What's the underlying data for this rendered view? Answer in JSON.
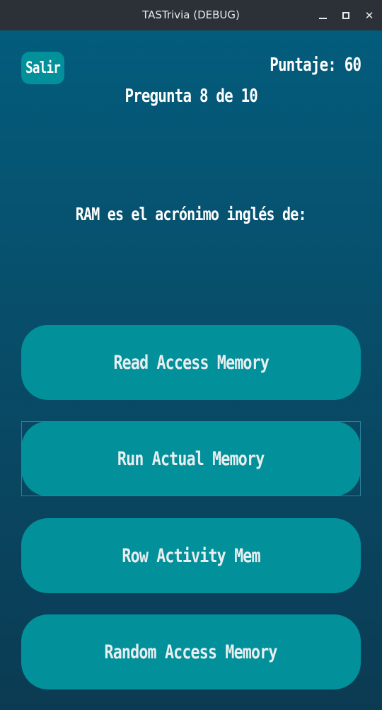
{
  "window": {
    "title": "TASTrivia (DEBUG)",
    "minimize_icon": "minimize-icon",
    "maximize_icon": "maximize-icon",
    "close_icon": "close-icon",
    "close_glyph": "✕"
  },
  "game": {
    "exit_label": "Salir",
    "score_label": "Puntaje: 60",
    "question_progress": "Pregunta 8 de 10",
    "question_text": "RAM es el acrónimo inglés de:",
    "answers": [
      "Read Access Memory",
      "Run Actual Memory",
      "Row Activity Mem",
      "Random Access Memory"
    ]
  },
  "colors": {
    "titlebar": "#2b3136",
    "background_top": "#035c7c",
    "background_bottom": "#0b3b53",
    "button": "#02909a",
    "text": "#ffffff"
  }
}
